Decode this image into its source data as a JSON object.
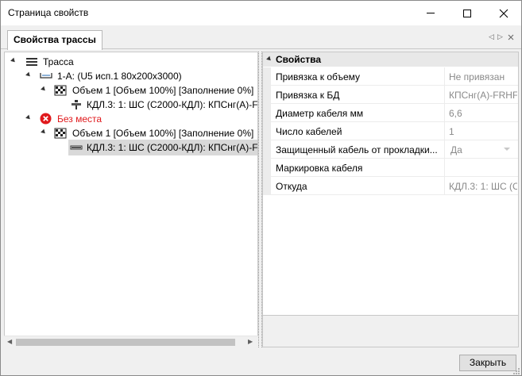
{
  "window": {
    "title": "Страница свойств"
  },
  "tabs": [
    {
      "label": "Свойства трассы"
    }
  ],
  "tree": {
    "nodes": [
      {
        "label": "Трасса",
        "icon": "route-icon"
      },
      {
        "label": "1-А: (U5 исп.1 80х200х3000)",
        "icon": "tray-icon"
      },
      {
        "label": "Объем 1 [Объем 100%] [Заполнение 0%]",
        "icon": "volume-grid-icon"
      },
      {
        "label": "КДЛ.3: 1: ШС  (С2000-КДЛ): КПСнг(А)-F",
        "icon": "cable-connect-icon"
      },
      {
        "label": "Без места",
        "icon": "error-icon",
        "color": "#e0191c"
      },
      {
        "label": "Объем 1 [Объем 100%] [Заполнение 0%]",
        "icon": "volume-grid-icon"
      },
      {
        "label": "КДЛ.3: 1: ШС  (С2000-КДЛ): КПСнг(А)-F",
        "icon": "cable-icon",
        "selected": true
      }
    ]
  },
  "properties": {
    "category": "Свойства",
    "rows": [
      {
        "name": "Привязка к объему",
        "value": "Не привязан"
      },
      {
        "name": "Привязка к БД",
        "value": "КПСнг(А)-FRHF"
      },
      {
        "name": "Диаметр кабеля мм",
        "value": "6,6"
      },
      {
        "name": "Число кабелей",
        "value": "1"
      },
      {
        "name": "Защищенный кабель от прокладки...",
        "value": "Да",
        "dropdown": true
      },
      {
        "name": "Маркировка кабеля",
        "value": ""
      },
      {
        "name": "Откуда",
        "value": "КДЛ.3: 1: ШС  (С"
      }
    ]
  },
  "footer": {
    "close_label": "Закрыть"
  },
  "colors": {
    "error_red": "#e0191c",
    "selection": "#d9d9d9",
    "value_gray": "#8a8a8a"
  }
}
